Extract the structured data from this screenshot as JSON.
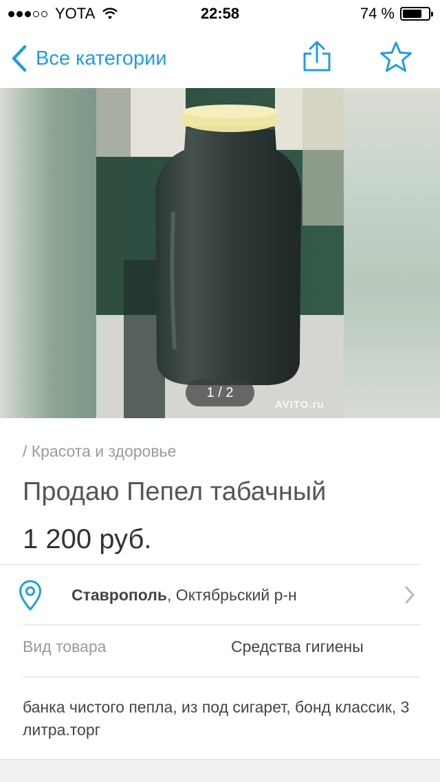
{
  "status_bar": {
    "carrier": "YOTA",
    "time": "22:58",
    "battery": "74 %",
    "battery_level": 0.74,
    "signal_bars_filled": 3,
    "signal_bars_total": 5
  },
  "nav": {
    "back_label": "Все категории",
    "accent_color": "#1e9be6"
  },
  "gallery": {
    "counter": "1 / 2",
    "watermark": "AVITO.ru"
  },
  "listing": {
    "breadcrumb": "/ Красота и здоровье",
    "title": "Продаю Пепел табачный",
    "price": "1 200 руб.",
    "location_city": "Ставрополь",
    "location_district": ", Октябрьский р-н",
    "param_label": "Вид товара",
    "param_value": "Средства гигиены",
    "description": "банка чистого пепла, из под сигарет, бонд классик, 3 литра.торг"
  },
  "icons": {
    "back": "chevron-left-icon",
    "share": "share-icon",
    "favorite": "star-icon",
    "location": "map-pin-icon",
    "disclosure": "chevron-right-icon",
    "wifi": "wifi-icon",
    "battery": "battery-icon"
  }
}
